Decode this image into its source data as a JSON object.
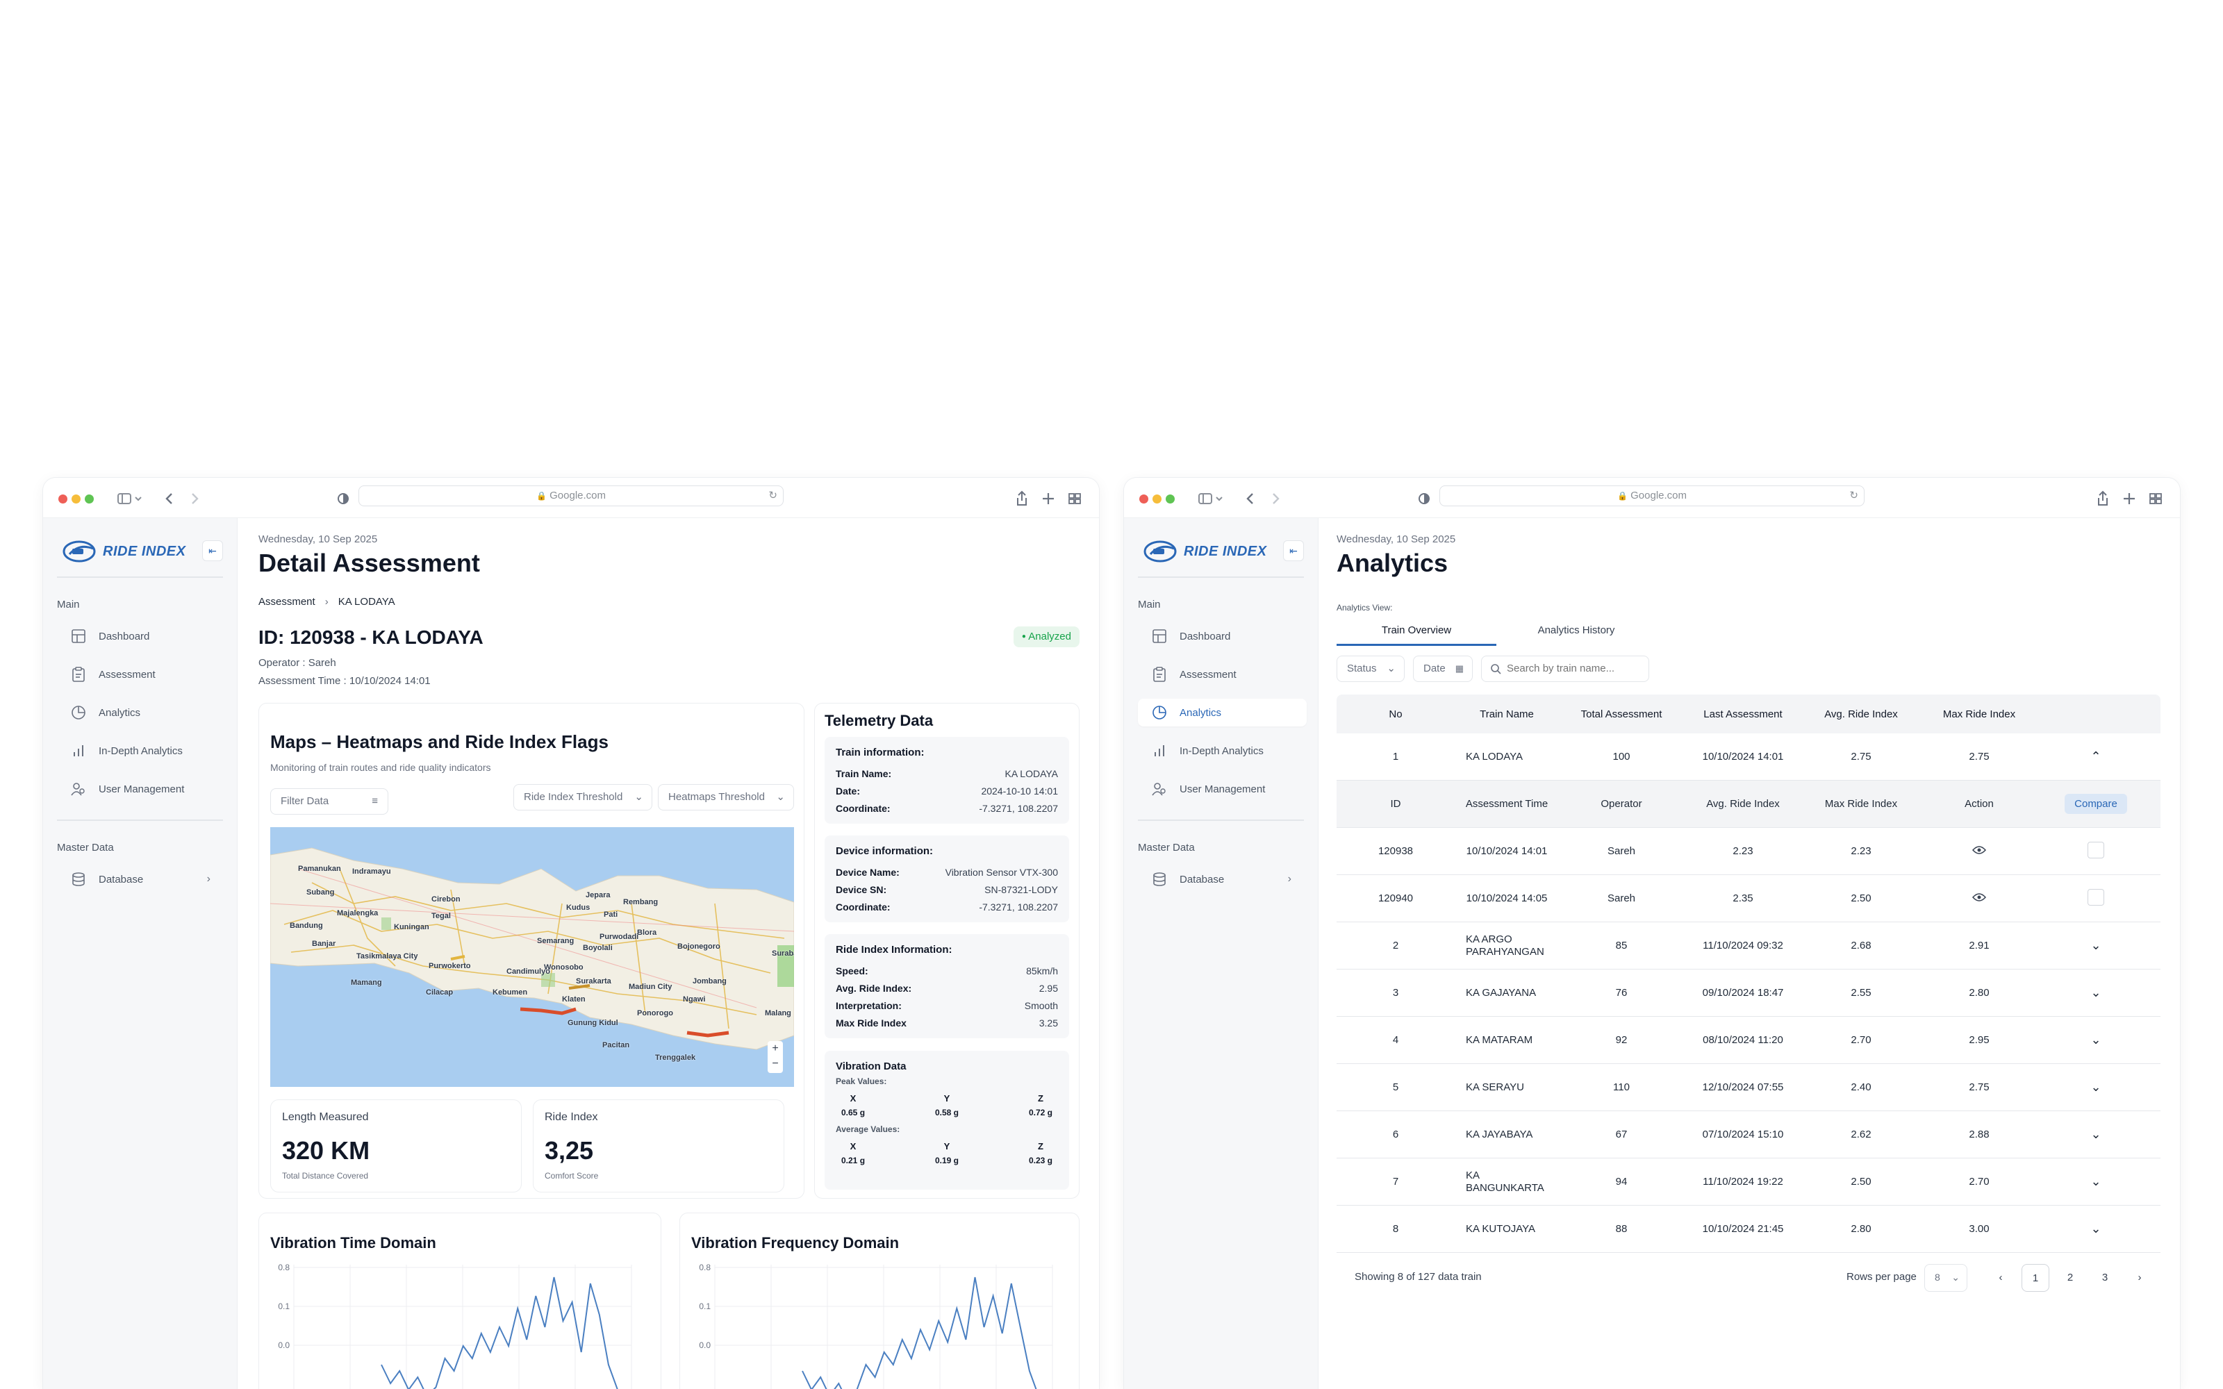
{
  "browser": {
    "url": "Google.com"
  },
  "sidebar": {
    "brand": "RIDE INDEX",
    "section_main": "Main",
    "section_master": "Master Data",
    "items": [
      {
        "label": "Dashboard",
        "icon": "dashboard-icon"
      },
      {
        "label": "Assessment",
        "icon": "clipboard-icon"
      },
      {
        "label": "Analytics",
        "icon": "pie-chart-icon"
      },
      {
        "label": "In-Depth Analytics",
        "icon": "bar-chart-icon"
      },
      {
        "label": "User Management",
        "icon": "users-icon"
      }
    ],
    "database_label": "Database"
  },
  "detail": {
    "date": "Wednesday, 10 Sep 2025",
    "title": "Detail Assessment",
    "breadcrumb_root": "Assessment",
    "breadcrumb_current": "KA LODAYA",
    "id_title": "ID: 120938 - KA LODAYA",
    "status": "Analyzed",
    "operator": "Operator : Sareh",
    "assessment_time": "Assessment Time : 10/10/2024 14:01",
    "map_title": "Maps – Heatmaps and Ride Index Flags",
    "map_subtitle": "Monitoring of train routes and ride quality indicators",
    "filter_label": "Filter Data",
    "ride_threshold": "Ride Index Threshold",
    "heat_threshold": "Heatmaps Threshold",
    "cities": [
      "Pamanukan",
      "Indramayu",
      "Subang",
      "Cirebon",
      "Majalengka",
      "Tegal",
      "Bandung",
      "Kuningan",
      "Jepara",
      "Rembang",
      "Kudus",
      "Pati",
      "Purwokerto",
      "Semarang",
      "Blora",
      "Bojonegoro",
      "Tasikmalaya City",
      "Cilacap",
      "Kebumen",
      "Surakarta",
      "Madiun City",
      "Jombang",
      "Surabaya",
      "Klaten",
      "Gunung Kidul",
      "Ponorogo",
      "Pacitan",
      "Trenggalek",
      "Malang",
      "Ngawi",
      "Wonosobo",
      "Boyolali",
      "Banjar",
      "Mamang",
      "Purwodadi",
      "Candimulyo"
    ],
    "length_label": "Length Measured",
    "length_value": "320 KM",
    "length_sub": "Total Distance Covered",
    "ri_label": "Ride Index",
    "ri_value": "3,25",
    "ri_sub": "Comfort Score",
    "telemetry_title": "Telemetry Data",
    "train_info": {
      "title": "Train information:",
      "rows": [
        {
          "k": "Train Name:",
          "v": "KA LODAYA"
        },
        {
          "k": "Date:",
          "v": "2024-10-10 14:01"
        },
        {
          "k": "Coordinate:",
          "v": "-7.3271, 108.2207"
        }
      ]
    },
    "device_info": {
      "title": "Device information:",
      "rows": [
        {
          "k": "Device Name:",
          "v": "Vibration Sensor VTX-300"
        },
        {
          "k": "Device SN:",
          "v": "SN-87321-LODY"
        },
        {
          "k": "Coordinate:",
          "v": "-7.3271, 108.2207"
        }
      ]
    },
    "ride_info": {
      "title": "Ride Index Information:",
      "rows": [
        {
          "k": "Speed:",
          "v": "85km/h"
        },
        {
          "k": "Avg. Ride Index:",
          "v": "2.95"
        },
        {
          "k": "Interpretation:",
          "v": "Smooth"
        },
        {
          "k": "Max Ride Index",
          "v": "3.25"
        }
      ]
    },
    "vibration": {
      "title": "Vibration Data",
      "peak_label": "Peak Values:",
      "avg_label": "Average Values:",
      "axes": [
        "X",
        "Y",
        "Z"
      ],
      "peak": [
        "0.65 g",
        "0.58 g",
        "0.72 g"
      ],
      "avg": [
        "0.21 g",
        "0.19 g",
        "0.23 g"
      ]
    },
    "time_domain_title": "Vibration Time Domain",
    "freq_domain_title": "Vibration Frequency Domain",
    "y_ticks": [
      "0.8",
      "0.1",
      "0.0"
    ]
  },
  "chart_data": [
    {
      "type": "line",
      "title": "Vibration Time Domain",
      "xlabel": "",
      "ylabel": "",
      "y_ticks": [
        "0.8",
        "0.1",
        "0.0"
      ],
      "values": [
        0.0,
        -0.15,
        -0.05,
        -0.2,
        -0.1,
        -0.25,
        -0.18,
        0.05,
        -0.05,
        0.15,
        0.05,
        0.25,
        0.1,
        0.3,
        0.15,
        0.45,
        0.2,
        0.55,
        0.3,
        0.7,
        0.35,
        0.5,
        0.1,
        0.65,
        0.4,
        0.0,
        -0.2
      ]
    },
    {
      "type": "line",
      "title": "Vibration Frequency Domain",
      "xlabel": "",
      "ylabel": "",
      "y_ticks": [
        "0.8",
        "0.1",
        "0.0"
      ],
      "values": [
        -0.05,
        -0.2,
        -0.1,
        -0.25,
        -0.15,
        -0.3,
        -0.2,
        0.0,
        -0.1,
        0.1,
        0.0,
        0.2,
        0.05,
        0.28,
        0.12,
        0.35,
        0.18,
        0.45,
        0.2,
        0.7,
        0.3,
        0.55,
        0.25,
        0.65,
        0.3,
        -0.05,
        -0.25
      ]
    }
  ],
  "analytics": {
    "date": "Wednesday, 10 Sep 2025",
    "title": "Analytics",
    "view_label": "Analytics View:",
    "tabs": [
      "Train Overview",
      "Analytics History"
    ],
    "status_filter": "Status",
    "date_filter": "Date",
    "search_placeholder": "Search by train name...",
    "headers": [
      "No",
      "Train Name",
      "Total Assessment",
      "Last Assessment",
      "Avg. Ride Index",
      "Max Ride Index"
    ],
    "sub_headers": [
      "ID",
      "Assessment Time",
      "Operator",
      "Avg. Ride Index",
      "Max Ride Index",
      "Action"
    ],
    "compare_label": "Compare",
    "expanded_row": {
      "no": "1",
      "name": "KA LODAYA",
      "total": "100",
      "last": "10/10/2024 14:01",
      "avg": "2.75",
      "max": "2.75"
    },
    "sub_rows": [
      {
        "id": "120938",
        "time": "10/10/2024 14:01",
        "operator": "Sareh",
        "avg": "2.23",
        "max": "2.23"
      },
      {
        "id": "120940",
        "time": "10/10/2024 14:05",
        "operator": "Sareh",
        "avg": "2.35",
        "max": "2.50"
      }
    ],
    "rows": [
      {
        "no": "2",
        "name": "KA ARGO PARAHYANGAN",
        "total": "85",
        "last": "11/10/2024 09:32",
        "avg": "2.68",
        "max": "2.91"
      },
      {
        "no": "3",
        "name": "KA GAJAYANA",
        "total": "76",
        "last": "09/10/2024 18:47",
        "avg": "2.55",
        "max": "2.80"
      },
      {
        "no": "4",
        "name": "KA MATARAM",
        "total": "92",
        "last": "08/10/2024 11:20",
        "avg": "2.70",
        "max": "2.95"
      },
      {
        "no": "5",
        "name": "KA SERAYU",
        "total": "110",
        "last": "12/10/2024 07:55",
        "avg": "2.40",
        "max": "2.75"
      },
      {
        "no": "6",
        "name": "KA JAYABAYA",
        "total": "67",
        "last": "07/10/2024 15:10",
        "avg": "2.62",
        "max": "2.88"
      },
      {
        "no": "7",
        "name": "KA BANGUNKARTA",
        "total": "94",
        "last": "11/10/2024 19:22",
        "avg": "2.50",
        "max": "2.70"
      },
      {
        "no": "8",
        "name": "KA KUTOJAYA",
        "total": "88",
        "last": "10/10/2024 21:45",
        "avg": "2.80",
        "max": "3.00"
      }
    ],
    "showing": "Showing 8 of 127 data train",
    "rows_per_page_label": "Rows per page",
    "rows_per_page": "8",
    "pages": [
      "1",
      "2",
      "3"
    ]
  },
  "colors": {
    "accent": "#2a67b6",
    "status_green": "#16a34a",
    "line": "#4a7fc1"
  }
}
